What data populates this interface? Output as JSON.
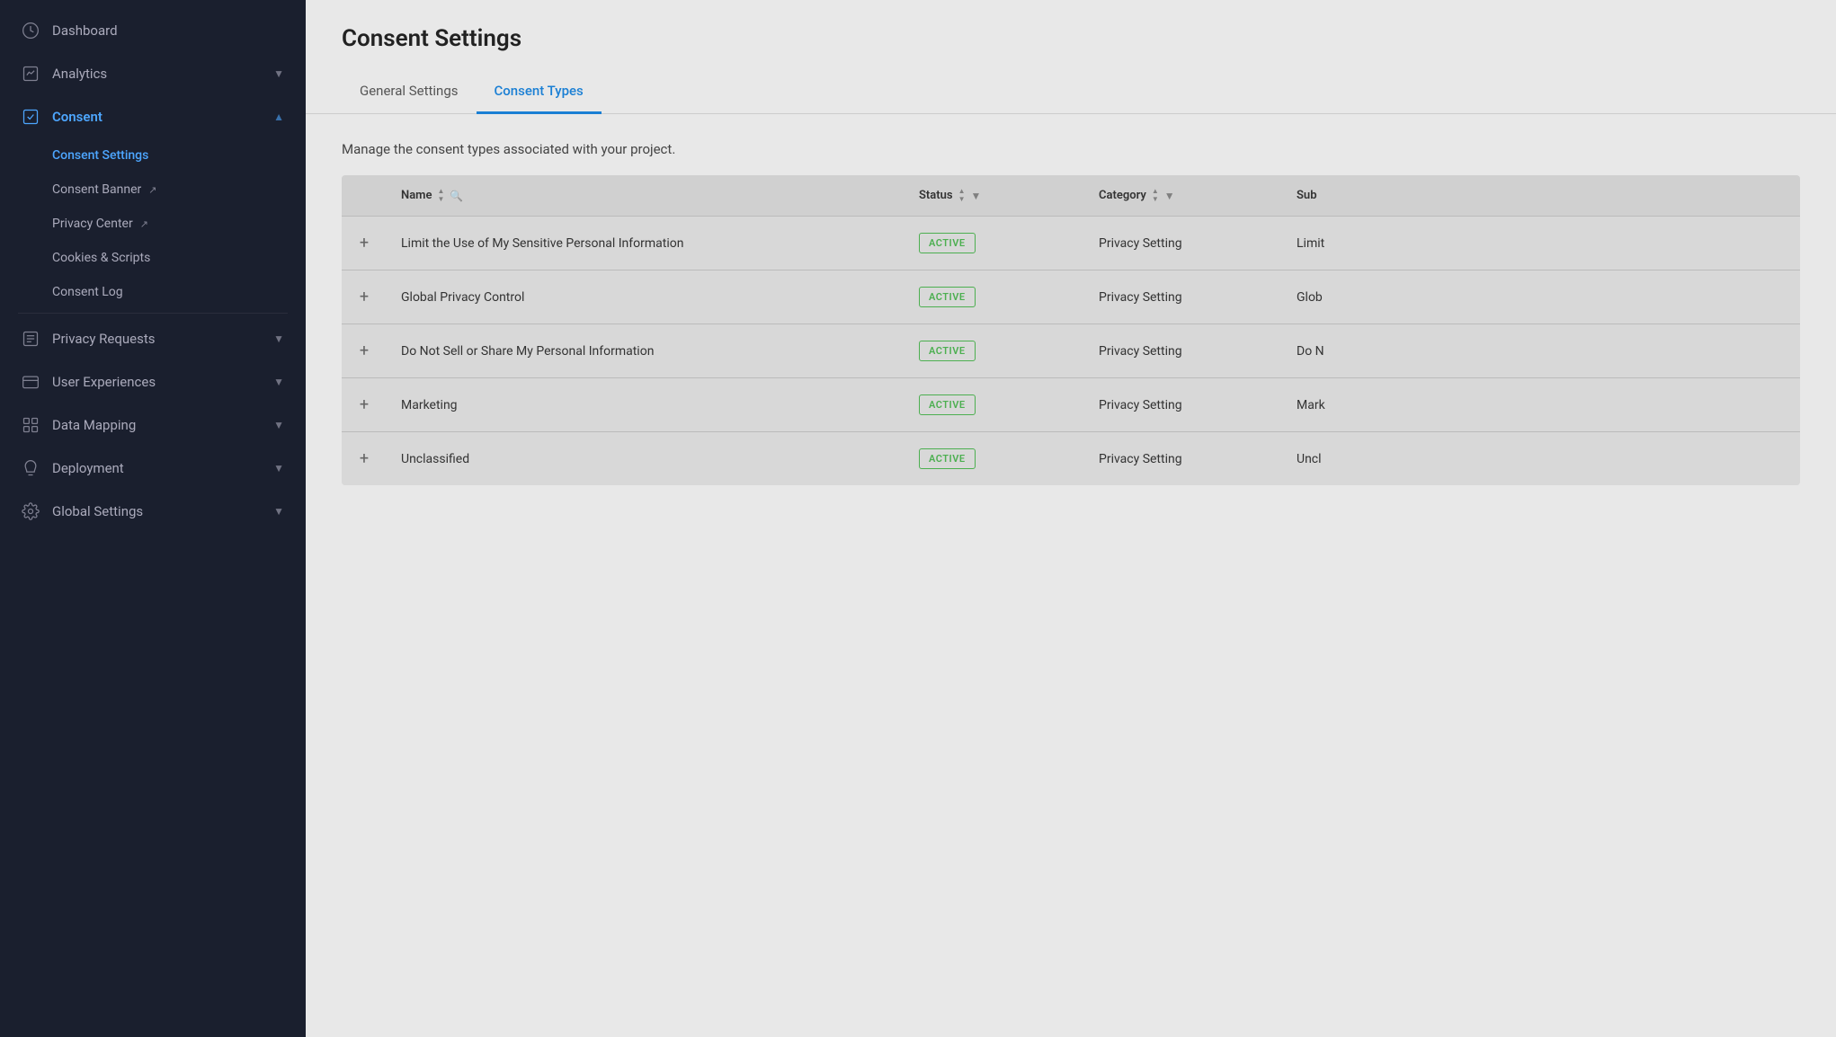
{
  "sidebar": {
    "items": [
      {
        "id": "dashboard",
        "label": "Dashboard",
        "icon": "dashboard",
        "hasChevron": false
      },
      {
        "id": "analytics",
        "label": "Analytics",
        "icon": "analytics",
        "hasChevron": true,
        "expanded": false
      },
      {
        "id": "consent",
        "label": "Consent",
        "icon": "consent",
        "hasChevron": true,
        "expanded": true,
        "active": true
      },
      {
        "id": "privacy-requests",
        "label": "Privacy Requests",
        "icon": "privacy",
        "hasChevron": true,
        "expanded": false
      },
      {
        "id": "user-experiences",
        "label": "User Experiences",
        "icon": "user-exp",
        "hasChevron": true,
        "expanded": false
      },
      {
        "id": "data-mapping",
        "label": "Data Mapping",
        "icon": "data-map",
        "hasChevron": true,
        "expanded": false
      },
      {
        "id": "deployment",
        "label": "Deployment",
        "icon": "deploy",
        "hasChevron": true,
        "expanded": false
      },
      {
        "id": "global-settings",
        "label": "Global Settings",
        "icon": "settings",
        "hasChevron": true,
        "expanded": false
      }
    ],
    "consent_sub_items": [
      {
        "id": "consent-settings",
        "label": "Consent Settings",
        "active": true,
        "external": false
      },
      {
        "id": "consent-banner",
        "label": "Consent Banner",
        "active": false,
        "external": true
      },
      {
        "id": "privacy-center",
        "label": "Privacy Center",
        "active": false,
        "external": true
      },
      {
        "id": "cookies-scripts",
        "label": "Cookies & Scripts",
        "active": false,
        "external": false
      },
      {
        "id": "consent-log",
        "label": "Consent Log",
        "active": false,
        "external": false
      }
    ]
  },
  "page": {
    "title": "Consent Settings",
    "description": "Manage the consent types associated with your project."
  },
  "tabs": [
    {
      "id": "general-settings",
      "label": "General Settings",
      "active": false
    },
    {
      "id": "consent-types",
      "label": "Consent Types",
      "active": true
    }
  ],
  "table": {
    "columns": [
      {
        "id": "expand",
        "label": ""
      },
      {
        "id": "name",
        "label": "Name",
        "sortable": true,
        "searchable": true
      },
      {
        "id": "status",
        "label": "Status",
        "sortable": true,
        "filterable": true
      },
      {
        "id": "category",
        "label": "Category",
        "sortable": true,
        "filterable": true
      },
      {
        "id": "sub",
        "label": "Sub"
      }
    ],
    "rows": [
      {
        "id": 1,
        "name": "Limit the Use of My Sensitive Personal Information",
        "status": "ACTIVE",
        "category": "Privacy Setting",
        "sub": "Limit"
      },
      {
        "id": 2,
        "name": "Global Privacy Control",
        "status": "ACTIVE",
        "category": "Privacy Setting",
        "sub": "Glob"
      },
      {
        "id": 3,
        "name": "Do Not Sell or Share My Personal Information",
        "status": "ACTIVE",
        "category": "Privacy Setting",
        "sub": "Do N"
      },
      {
        "id": 4,
        "name": "Marketing",
        "status": "ACTIVE",
        "category": "Privacy Setting",
        "sub": "Mark"
      },
      {
        "id": 5,
        "name": "Unclassified",
        "status": "ACTIVE",
        "category": "Privacy Setting",
        "sub": "Uncl"
      }
    ]
  },
  "colors": {
    "sidebar_bg": "#1a1f2e",
    "accent_blue": "#4da6ff",
    "active_green": "#4caf50"
  }
}
